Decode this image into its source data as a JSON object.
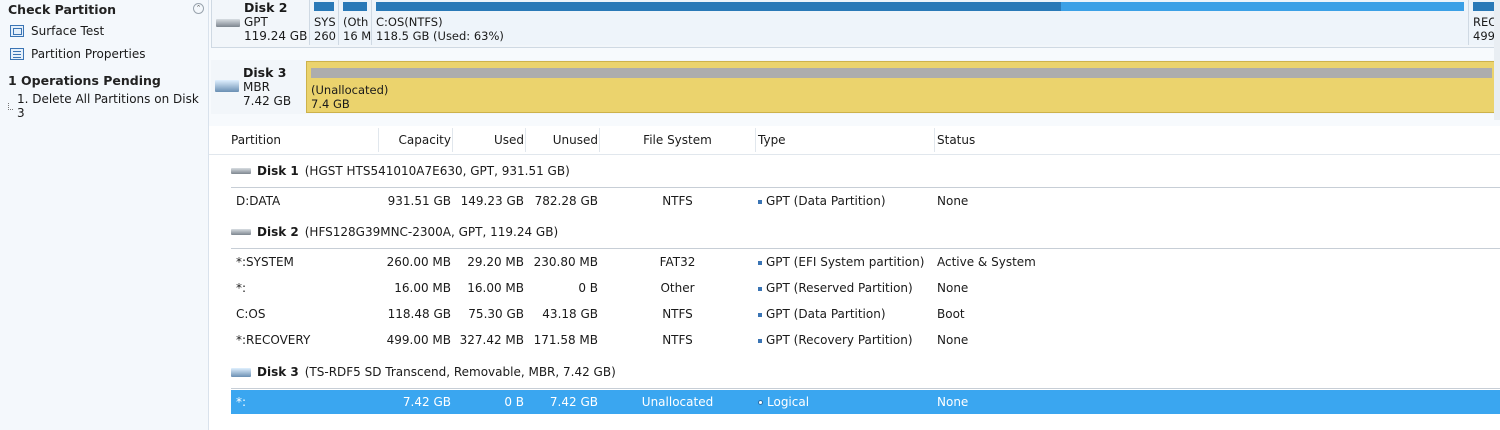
{
  "sidebar": {
    "group_title": "Check Partition",
    "items": [
      {
        "label": "Surface Test",
        "icon": "surface-test-icon"
      },
      {
        "label": "Partition Properties",
        "icon": "partition-properties-icon"
      }
    ],
    "pending_title": "1 Operations Pending",
    "pending_items": [
      "1. Delete All Partitions on Disk 3"
    ]
  },
  "disk_map": {
    "disk2": {
      "name": "Disk 2",
      "style": "GPT",
      "size": "119.24 GB",
      "partitions": [
        {
          "label1": "SYS",
          "label2": "260"
        },
        {
          "label1": "(Oth",
          "label2": "16 M"
        },
        {
          "label1": "C:OS(NTFS)",
          "label2": "118.5 GB (Used: 63%)",
          "used_fraction": 0.63
        },
        {
          "label1": "REC",
          "label2": "499"
        }
      ]
    },
    "disk3": {
      "name": "Disk 3",
      "style": "MBR",
      "size": "7.42 GB",
      "partition": {
        "label1": "(Unallocated)",
        "label2": "7.4 GB"
      }
    }
  },
  "table": {
    "headers": {
      "partition": "Partition",
      "capacity": "Capacity",
      "used": "Used",
      "unused": "Unused",
      "file_system": "File System",
      "type": "Type",
      "status": "Status"
    },
    "groups": [
      {
        "disk": "Disk 1",
        "detail": "(HGST HTS541010A7E630, GPT, 931.51 GB)",
        "rows": [
          {
            "partition": "D:DATA",
            "capacity": "931.51 GB",
            "used": "149.23 GB",
            "unused": "782.28 GB",
            "fs": "NTFS",
            "type": "GPT (Data Partition)",
            "status": "None"
          }
        ]
      },
      {
        "disk": "Disk 2",
        "detail": "(HFS128G39MNC-2300A, GPT, 119.24 GB)",
        "rows": [
          {
            "partition": "*:SYSTEM",
            "capacity": "260.00 MB",
            "used": "29.20 MB",
            "unused": "230.80 MB",
            "fs": "FAT32",
            "type": "GPT (EFI System partition)",
            "status": "Active & System"
          },
          {
            "partition": "*:",
            "capacity": "16.00 MB",
            "used": "16.00 MB",
            "unused": "0 B",
            "fs": "Other",
            "type": "GPT (Reserved Partition)",
            "status": "None"
          },
          {
            "partition": "C:OS",
            "capacity": "118.48 GB",
            "used": "75.30 GB",
            "unused": "43.18 GB",
            "fs": "NTFS",
            "type": "GPT (Data Partition)",
            "status": "Boot"
          },
          {
            "partition": "*:RECOVERY",
            "capacity": "499.00 MB",
            "used": "327.42 MB",
            "unused": "171.58 MB",
            "fs": "NTFS",
            "type": "GPT (Recovery Partition)",
            "status": "None"
          }
        ]
      },
      {
        "disk": "Disk 3",
        "detail": "(TS-RDF5 SD Transcend, Removable, MBR, 7.42 GB)",
        "rows": [
          {
            "partition": "*:",
            "capacity": "7.42 GB",
            "used": "0 B",
            "unused": "7.42 GB",
            "fs": "Unallocated",
            "type": "Logical",
            "status": "None",
            "selected": true
          }
        ]
      }
    ]
  },
  "colors": {
    "selection": "#3aa6f0",
    "unallocated": "#ebd36d",
    "used_bar": "#2a79b7",
    "free_bar": "#3ba0e6"
  }
}
